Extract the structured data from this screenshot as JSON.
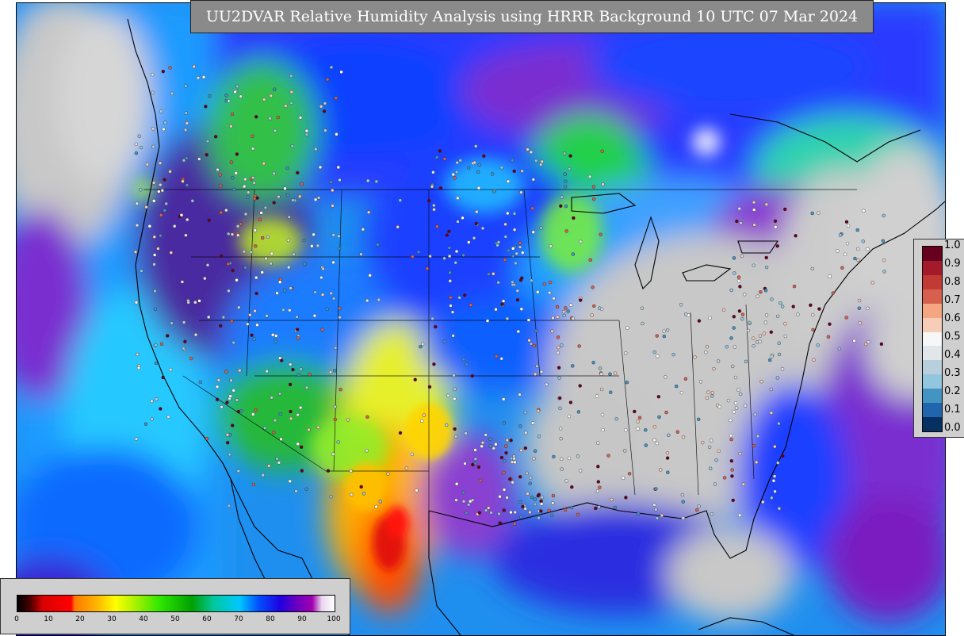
{
  "title": "UU2DVAR Relative Humidity Analysis using HRRR Background 10 UTC 07 Mar 2024",
  "legend_observations": {
    "labels": [
      "1.0",
      "0.9",
      "0.8",
      "0.7",
      "0.6",
      "0.5",
      "0.4",
      "0.3",
      "0.2",
      "0.1",
      "0.0"
    ],
    "colors": [
      "#67001f",
      "#a31a2a",
      "#c23a34",
      "#d6604d",
      "#f4a582",
      "#f7cdb8",
      "#f7f7f7",
      "#e0e6ea",
      "#b9cfdc",
      "#92c5de",
      "#4393c3",
      "#2166ac",
      "#053061"
    ]
  },
  "legend_analysis": {
    "ticks": [
      "0",
      "10",
      "20",
      "30",
      "40",
      "50",
      "60",
      "70",
      "80",
      "90",
      "100"
    ],
    "stops": [
      {
        "v": 0,
        "c": "#000000"
      },
      {
        "v": 4,
        "c": "#4a0000"
      },
      {
        "v": 8,
        "c": "#d90000"
      },
      {
        "v": 17,
        "c": "#ff0000"
      },
      {
        "v": 18,
        "c": "#ff7800"
      },
      {
        "v": 25,
        "c": "#ffb400"
      },
      {
        "v": 31,
        "c": "#ffff00"
      },
      {
        "v": 38,
        "c": "#9cf000"
      },
      {
        "v": 45,
        "c": "#2ee600"
      },
      {
        "v": 55,
        "c": "#00a000"
      },
      {
        "v": 62,
        "c": "#00c8a0"
      },
      {
        "v": 70,
        "c": "#00c8ff"
      },
      {
        "v": 76,
        "c": "#0050ff"
      },
      {
        "v": 83,
        "c": "#2000e0"
      },
      {
        "v": 88,
        "c": "#6a00c0"
      },
      {
        "v": 93,
        "c": "#a000b0"
      },
      {
        "v": 96,
        "c": "#e8d8ee"
      },
      {
        "v": 100,
        "c": "#ffffff"
      }
    ]
  }
}
